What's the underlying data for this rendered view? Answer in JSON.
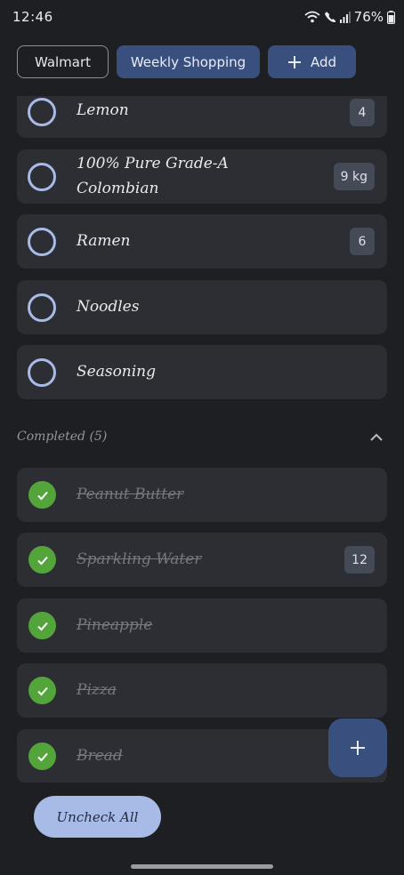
{
  "status_bar": {
    "time": "12:46",
    "battery": "76%",
    "icons": [
      "wifi-icon",
      "call-icon",
      "signal-icon",
      "battery-icon"
    ]
  },
  "chips": {
    "store": "Walmart",
    "list": "Weekly Shopping",
    "add": "Add"
  },
  "items": [
    {
      "label": "Lemon",
      "qty": "4"
    },
    {
      "label_line1": "100% Pure Grade-A",
      "label_line2": "Colombian",
      "qty": "9 kg"
    },
    {
      "label": "Ramen",
      "qty": "6"
    },
    {
      "label": "Noodles"
    },
    {
      "label": "Seasoning"
    }
  ],
  "completed": {
    "title": "Completed (5)",
    "items": [
      {
        "label": "Peanut Butter"
      },
      {
        "label": "Sparkling Water",
        "qty": "12"
      },
      {
        "label": "Pineapple"
      },
      {
        "label": "Pizza"
      },
      {
        "label": "Bread"
      }
    ]
  },
  "actions": {
    "uncheck_all": "Uncheck All",
    "fab_icon": "plus-icon"
  },
  "colors": {
    "background": "#1e1f23",
    "card": "#2d2e33",
    "accent": "#39507f",
    "circle": "#a8bae6",
    "check": "#53a43a"
  }
}
